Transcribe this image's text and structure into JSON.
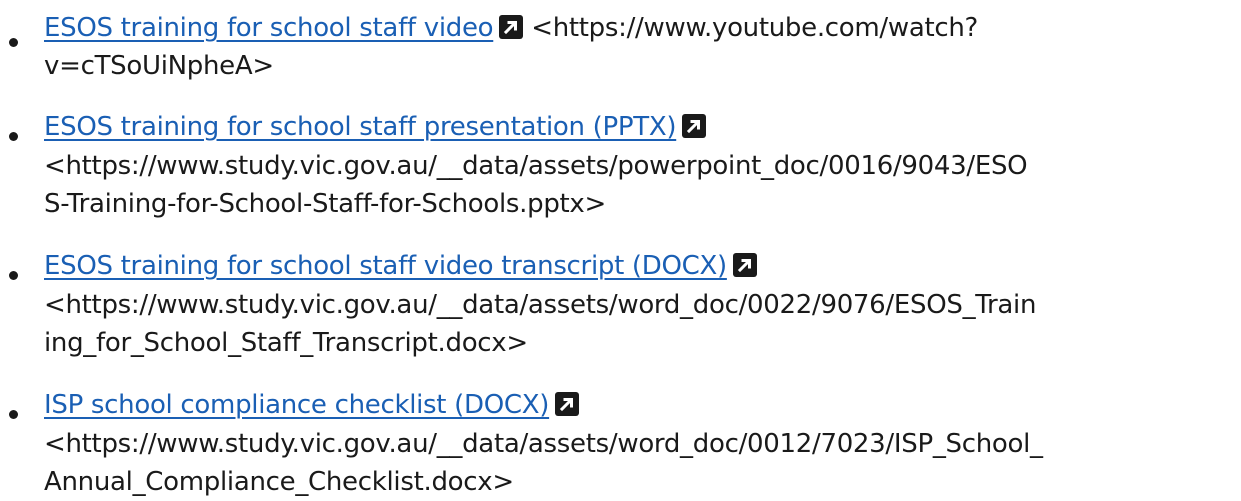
{
  "resources": [
    {
      "link_text": "ESOS training for school staff video",
      "url_lines": [
        "<https://www.youtube.com/watch?",
        "v=cTSoUiNpheA>"
      ],
      "icon": "external-link-icon"
    },
    {
      "link_text": "ESOS training for school staff presentation (PPTX)",
      "url_lines": [
        "<https://www.study.vic.gov.au/__data/assets/powerpoint_doc/0016/9043/ESO",
        "S-Training-for-School-Staff-for-Schools.pptx>"
      ],
      "icon": "external-link-icon"
    },
    {
      "link_text": "ESOS training for school staff video transcript (DOCX)",
      "url_lines": [
        "<https://www.study.vic.gov.au/__data/assets/word_doc/0022/9076/ESOS_Train",
        "ing_for_School_Staff_Transcript.docx>"
      ],
      "icon": "external-link-icon"
    },
    {
      "link_text": "ISP school compliance checklist (DOCX)",
      "url_lines": [
        "<https://www.study.vic.gov.au/__data/assets/word_doc/0012/7023/ISP_School_",
        "Annual_Compliance_Checklist.docx>"
      ],
      "icon": "external-link-icon"
    }
  ],
  "colors": {
    "link": "#1a5fb4",
    "text": "#1a1a1a"
  }
}
